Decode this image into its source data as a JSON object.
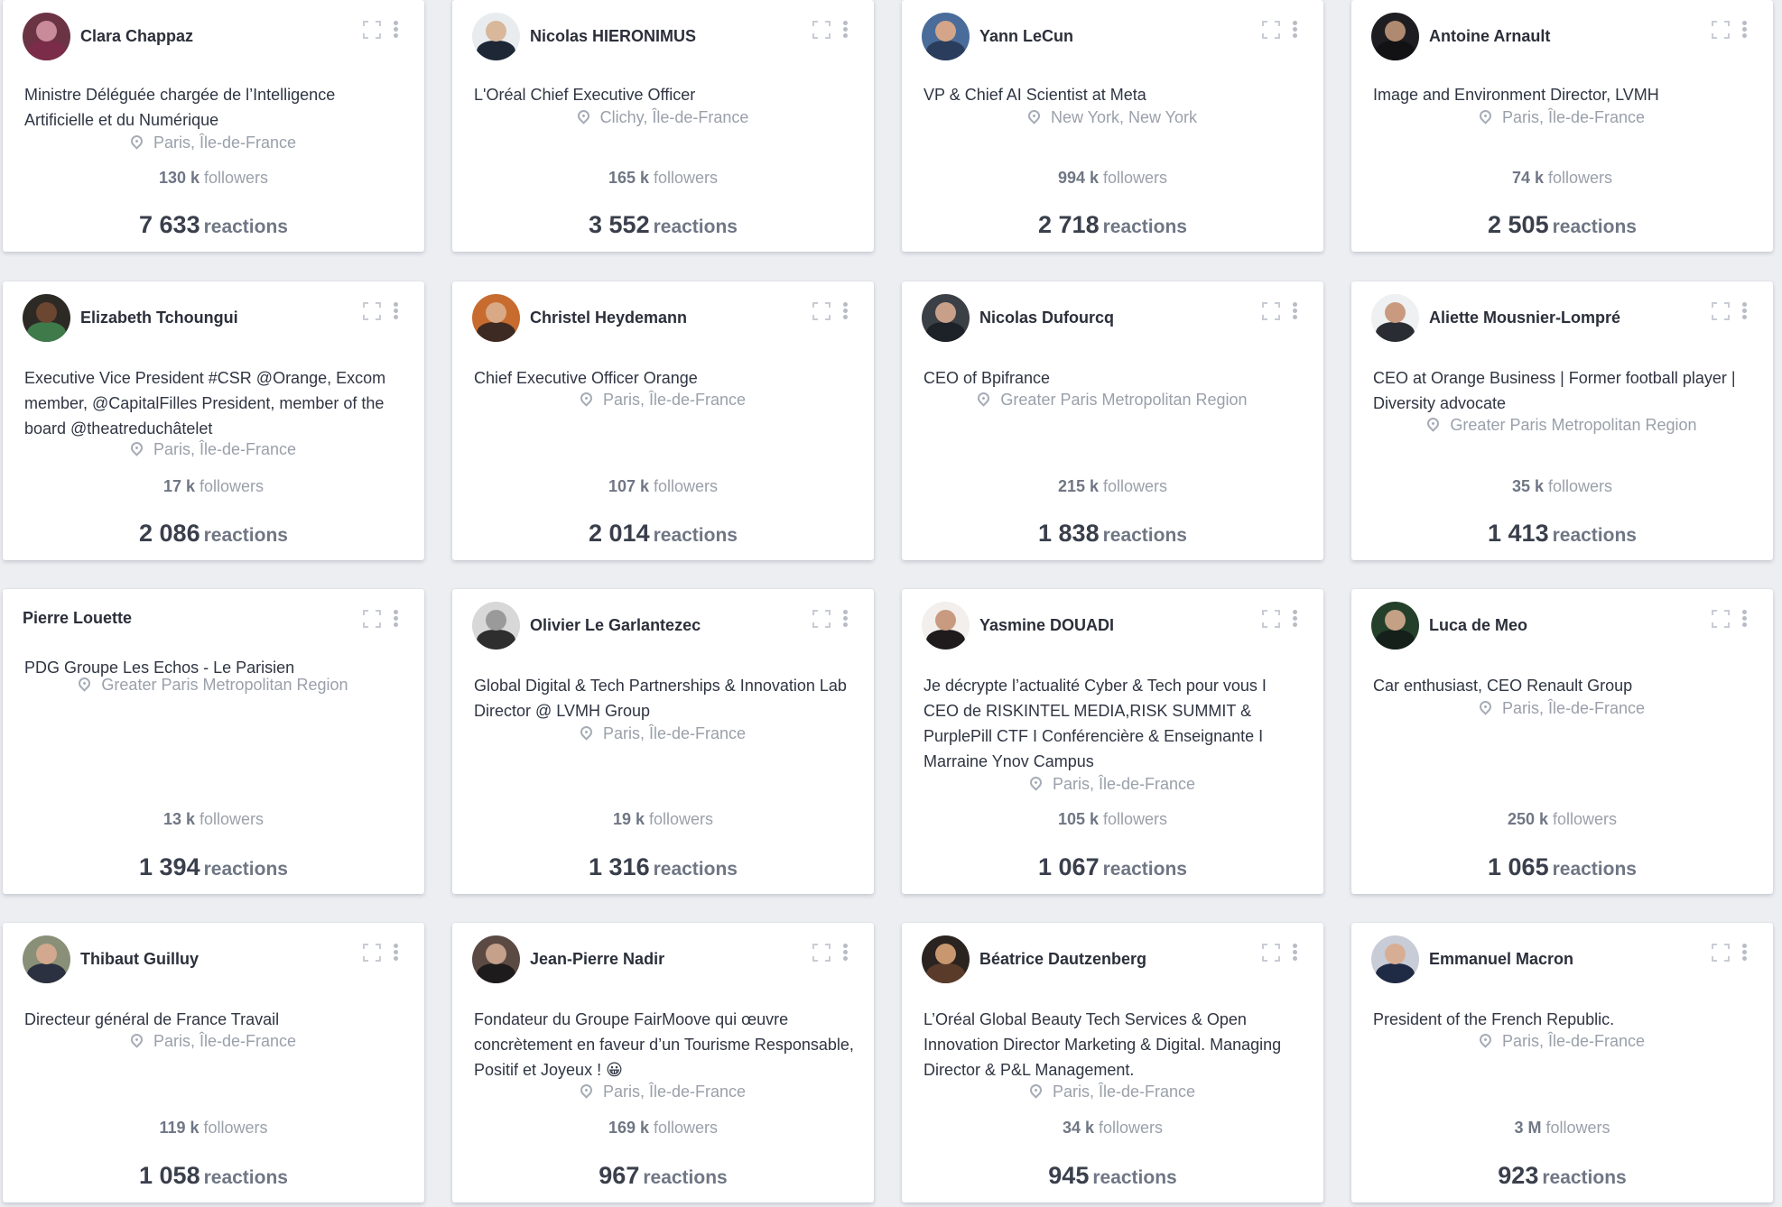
{
  "labels": {
    "followers": "followers",
    "reactions": "reactions"
  },
  "cards": [
    {
      "name": "Clara Chappaz",
      "title": "Ministre Déléguée chargée de l’Intelligence Artificielle et du Numérique",
      "location": "Paris, Île-de-France",
      "followers_value": "130 k",
      "reactions_value": "7 633",
      "avatar": true,
      "colors": [
        "#6b3445",
        "#c98a9a",
        "#7a2c48"
      ]
    },
    {
      "name": "Nicolas HIERONIMUS",
      "title": "L'Oréal Chief Executive Officer",
      "location": "Clichy, Île-de-France",
      "followers_value": "165 k",
      "reactions_value": "3 552",
      "avatar": true,
      "colors": [
        "#e9ecef",
        "#d8b79a",
        "#1d2736"
      ]
    },
    {
      "name": "Yann LeCun",
      "title": "VP & Chief AI Scientist at Meta",
      "location": "New York, New York",
      "followers_value": "994 k",
      "reactions_value": "2 718",
      "avatar": true,
      "colors": [
        "#4a6c9b",
        "#d4a588",
        "#2a3d5c"
      ]
    },
    {
      "name": "Antoine Arnault",
      "title": "Image and Environment Director, LVMH",
      "location": "Paris, Île-de-France",
      "followers_value": "74 k",
      "reactions_value": "2 505",
      "avatar": true,
      "colors": [
        "#1e1e22",
        "#b08a70",
        "#121214"
      ]
    },
    {
      "name": "Elizabeth Tchoungui",
      "title": "Executive Vice President #CSR @Orange, Excom member, @CapitalFilles President, member of the board @theatreduchâtelet",
      "location": "Paris, Île-de-France",
      "followers_value": "17 k",
      "reactions_value": "2 086",
      "avatar": true,
      "colors": [
        "#2d2a26",
        "#6b4631",
        "#3f7a4a"
      ]
    },
    {
      "name": "Christel Heydemann",
      "title": "Chief Executive Officer Orange",
      "location": "Paris, Île-de-France",
      "followers_value": "107 k",
      "reactions_value": "2 014",
      "avatar": true,
      "colors": [
        "#c76b2e",
        "#d9a884",
        "#3d2a22"
      ]
    },
    {
      "name": "Nicolas Dufourcq",
      "title": "CEO of Bpifrance",
      "location": "Greater Paris Metropolitan Region",
      "followers_value": "215 k",
      "reactions_value": "1 838",
      "avatar": true,
      "colors": [
        "#3b3f46",
        "#c8a08a",
        "#1d2128"
      ]
    },
    {
      "name": "Aliette Mousnier-Lompré",
      "title": "CEO at Orange Business | Former football player | Diversity advocate",
      "location": "Greater Paris Metropolitan Region",
      "followers_value": "35 k",
      "reactions_value": "1 413",
      "avatar": true,
      "colors": [
        "#eef0f2",
        "#c99a80",
        "#2a2c33"
      ]
    },
    {
      "name": "Pierre Louette",
      "title": "PDG Groupe Les Echos - Le Parisien",
      "location": "Greater Paris Metropolitan Region",
      "followers_value": "13 k",
      "reactions_value": "1 394",
      "avatar": false,
      "colors": [
        "#ffffff",
        "#ffffff",
        "#ffffff"
      ]
    },
    {
      "name": "Olivier Le Garlantezec",
      "title": "Global Digital & Tech Partnerships & Innovation Lab Director @ LVMH Group",
      "location": "Paris, Île-de-France",
      "followers_value": "19 k",
      "reactions_value": "1 316",
      "avatar": true,
      "colors": [
        "#d8d8d8",
        "#9a9a9a",
        "#2e2e2e"
      ]
    },
    {
      "name": "Yasmine DOUADI",
      "title": "Je décrypte l’actualité Cyber & Tech pour vous I CEO de RISKINTEL MEDIA,RISK SUMMIT & PurplePill CTF I Conférencière & Enseignante I Marraine Ynov Campus",
      "location": "Paris, Île-de-France",
      "followers_value": "105 k",
      "reactions_value": "1 067",
      "avatar": true,
      "colors": [
        "#f2efec",
        "#c89a80",
        "#1f1a1c"
      ]
    },
    {
      "name": "Luca de Meo",
      "title": "Car enthusiast, CEO Renault Group",
      "location": "Paris, Île-de-France",
      "followers_value": "250 k",
      "reactions_value": "1 065",
      "avatar": true,
      "colors": [
        "#25402a",
        "#c4a184",
        "#15201a"
      ]
    },
    {
      "name": "Thibaut Guilluy",
      "title": "Directeur général de France Travail",
      "location": "Paris, Île-de-France",
      "followers_value": "119 k",
      "reactions_value": "1 058",
      "avatar": true,
      "colors": [
        "#8a8f78",
        "#d2a98e",
        "#2b3140"
      ]
    },
    {
      "name": "Jean-Pierre Nadir",
      "title": "Fondateur du Groupe FairMoove qui œuvre concrètement en faveur d’un Tourisme Responsable, Positif et Joyeux ! 😀",
      "location": "Paris, Île-de-France",
      "followers_value": "169 k",
      "reactions_value": "967",
      "avatar": true,
      "colors": [
        "#5b4a44",
        "#c5a08a",
        "#1e1b1c"
      ]
    },
    {
      "name": "Béatrice Dautzenberg",
      "title": "L’Oréal Global Beauty Tech Services & Open Innovation Director Marketing & Digital. Managing Director & P&L Management.",
      "location": "Paris, Île-de-France",
      "followers_value": "34 k",
      "reactions_value": "945",
      "avatar": true,
      "colors": [
        "#2a2320",
        "#c9976f",
        "#5a3b2a"
      ]
    },
    {
      "name": "Emmanuel Macron",
      "title": "President of the French Republic.",
      "location": "Paris, Île-de-France",
      "followers_value": "3 M",
      "reactions_value": "923",
      "avatar": true,
      "colors": [
        "#c8ccd6",
        "#d7ad93",
        "#1f2a44"
      ]
    }
  ]
}
